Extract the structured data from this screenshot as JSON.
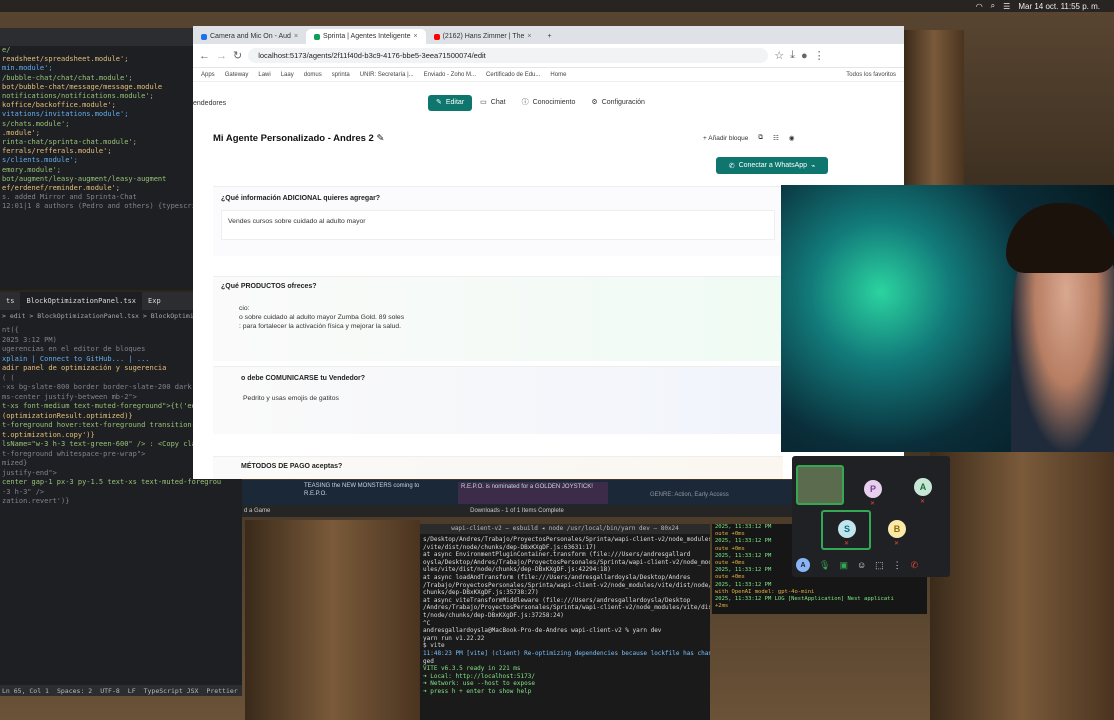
{
  "menubar": {
    "datetime": "Mar 14 oct.  11:55 p. m."
  },
  "browser": {
    "tabs": [
      {
        "label": "Camera and Mic On - Aud",
        "color": "#1a73e8",
        "active": false
      },
      {
        "label": "Sprinta | Agentes Inteligente",
        "color": "#0f9d58",
        "active": true
      },
      {
        "label": "(2162) Hans Zimmer | The",
        "color": "#ff0000",
        "active": false
      }
    ],
    "url": "localhost:5173/agents/2f11f40d-b3c9-4176-bbe5-3eea71500074/edit",
    "bookmarks": [
      "Apps",
      "Gateway",
      "Lawi",
      "Laay",
      "domus",
      "sprinta",
      "UNIR: Secretaría |...",
      "Enviado - Zoho M...",
      "Certificado de Edu...",
      "Home",
      "Todos los favoritos"
    ]
  },
  "app": {
    "nav_left": "endedores",
    "nav": [
      {
        "label": "Editar",
        "active": true
      },
      {
        "label": "Chat",
        "active": false
      },
      {
        "label": "Conocimiento",
        "active": false
      },
      {
        "label": "Configuración",
        "active": false
      }
    ],
    "agent_title": "Mi Agente Personalizado - Andres 2",
    "add_block": "Añadir bloque",
    "whatsapp_button": "Conectar a WhatsApp",
    "blocks": [
      {
        "question": "¿Qué información ADICIONAL quieres agregar?",
        "answer": [
          "Vendes cursos sobre cuidado al adulto mayor"
        ]
      },
      {
        "question": "¿Qué PRODUCTOS ofreces?",
        "answer": [
          "cio:",
          "o sobre cuidado al adulto mayor Zumba Gold. 89 soles",
          ": para fortalecer la activación física y mejorar la salud."
        ]
      },
      {
        "question": "o debe COMUNICARSE tu Vendedor?",
        "answer": [
          "Pedrito y usas emojis de gatitos"
        ]
      },
      {
        "question": "MÉTODOS DE PAGO aceptas?",
        "answer": []
      }
    ]
  },
  "editor_top": {
    "lines": [
      "e/",
      "readsheet/spreadsheet.module';",
      "min.module';",
      "/bubble-chat/chat/chat.module';",
      "bot/bubble-chat/message/message.module",
      "notifications/notifications.module';",
      "koffice/backoffice.module';",
      "vitations/invitations.module';",
      "s/chats.module';",
      ".module';",
      "rinta-chat/sprinta-chat.module';",
      "ferrals/refferals.module';",
      "s/clients.module';",
      "emory.module';",
      "",
      "bot/augment/leasy-augment/leasy-augment",
      "ef/erdenef/reminder.module';",
      "",
      "s. added Mirror and Sprinta-Chat",
      "12:01|1 8 authors (Pedro and others) {typescript Class"
    ]
  },
  "editor_bottom": {
    "tabs": [
      "ts",
      "BlockOptimizationPanel.tsx",
      "Exp"
    ],
    "breadcrumb": "> edit > BlockOptimizationPanel.tsx > BlockOptimizationPanel",
    "lines": [
      "nt({",
      "",
      "",
      "",
      " 2025 3:12 PM)",
      "",
      "ugerencias en el editor de bloques",
      "",
      "xplain  |  Connect to GitHub...  |  ...",
      "",
      "",
      "",
      "adir panel de optimización y sugerencia",
      "",
      "( (",
      "",
      "-xs bg-slate-800 border border-slate-200 dark:border",
      "ms-center justify-between mb-2\">",
      "t-xs font-medium text-muted-foreground\">{t('edit.edito",
      "",
      "(optimizationResult.optimized)}",
      "t-foreground hover:text-foreground transition-colors",
      "t.optimization.copy')}",
      "",
      "",
      "lsName=\"w-3 h-3 text-green-600\" /> : <Copy className",
      "",
      "",
      "",
      "t-foreground whitespace-pre-wrap\">",
      "mized}",
      "",
      "",
      "justify-end\">",
      "",
      "",
      "center gap-1 px-3 py-1.5 text-xs text-muted-foregrou",
      "",
      "-3 h-3\" />",
      "zation.revert')}"
    ],
    "status": [
      "Ln 65, Col 1",
      "Spaces: 2",
      "UTF-8",
      "LF",
      "TypeScript JSX",
      "Prettier"
    ]
  },
  "steam": {
    "left": "TEASING the NEW MONSTERS coming to R.E.P.O.",
    "right": "R.E.P.O. is nominated for a GOLDEN JOYSTICK!",
    "genre": "GENRE: Action, Early Access"
  },
  "downloads_bar": "Downloads - 1 of 1 Items Complete",
  "add_game": "d a Game",
  "terminal": {
    "title": "wapi-client-v2 — esbuild ◂ node /usr/local/bin/yarn dev — 80x24",
    "lines": [
      "s/Desktop/Andres/Trabajo/ProyectosPersonales/Sprinta/wapi-client-v2/node_modules",
      "/vite/dist/node/chunks/dep-DBxKXgDF.js:63631:17)",
      "    at async EnvironmentPluginContainer.transform (file:///Users/andresgallard",
      "oysla/Desktop/Andres/Trabajo/ProyectosPersonales/Sprinta/wapi-client-v2/node_mod",
      "ules/vite/dist/node/chunks/dep-DBxKXgDF.js:42294:18)",
      "    at async loadAndTransform (file:///Users/andresgallardoysla/Desktop/Andres",
      "/Trabajo/ProyectosPersonales/Sprinta/wapi-client-v2/node_modules/vite/dist/node/",
      "chunks/dep-DBxKXgDF.js:35738:27)",
      "    at async viteTransformMiddleware (file:///Users/andresgallardoysla/Desktop",
      "/Andres/Trabajo/ProyectosPersonales/Sprinta/wapi-client-v2/node_modules/vite/dis",
      "t/node/chunks/dep-DBxKXgDF.js:37258:24)",
      "^C",
      "andresgallardoysla@MacBook-Pro-de-Andres wapi-client-v2 % yarn dev",
      "yarn run v1.22.22",
      "$ vite",
      "11:48:23 PM [vite] (client) Re-optimizing dependencies because lockfile has chan",
      "ged",
      "",
      "  VITE v6.3.5  ready in 221 ms",
      "",
      "  ➜  Local:   http://localhost:5173/",
      "  ➜  Network: use --host to expose",
      "  ➜  press h + enter to show help"
    ]
  },
  "terminal_right": {
    "lines": [
      "2025, 11:33:12 PM",
      "oute +0ms",
      "2025, 11:33:12 PM",
      "oute +0ms",
      "2025, 11:33:12 PM",
      "oute +0ms",
      "2025, 11:33:12 PM",
      "oute +0ms",
      "2025, 11:33:12 PM",
      "with OpenAI model: gpt-4o-mini",
      "2025, 11:33:12 PM     LOG [NestApplication] Nest applicati",
      "+2ms"
    ]
  },
  "meet": {
    "participants": [
      {
        "initial": "P",
        "color": "#e6d0ee",
        "text_color": "#7b3f99"
      },
      {
        "initial": "A",
        "color": "#c8e6d6",
        "text_color": "#137333"
      },
      {
        "initial": "S",
        "color": "#c2e4ec",
        "text_color": "#0b6e7d"
      },
      {
        "initial": "B",
        "color": "#fbe9a8",
        "text_color": "#8a6d00"
      }
    ],
    "self_initial": "A"
  }
}
